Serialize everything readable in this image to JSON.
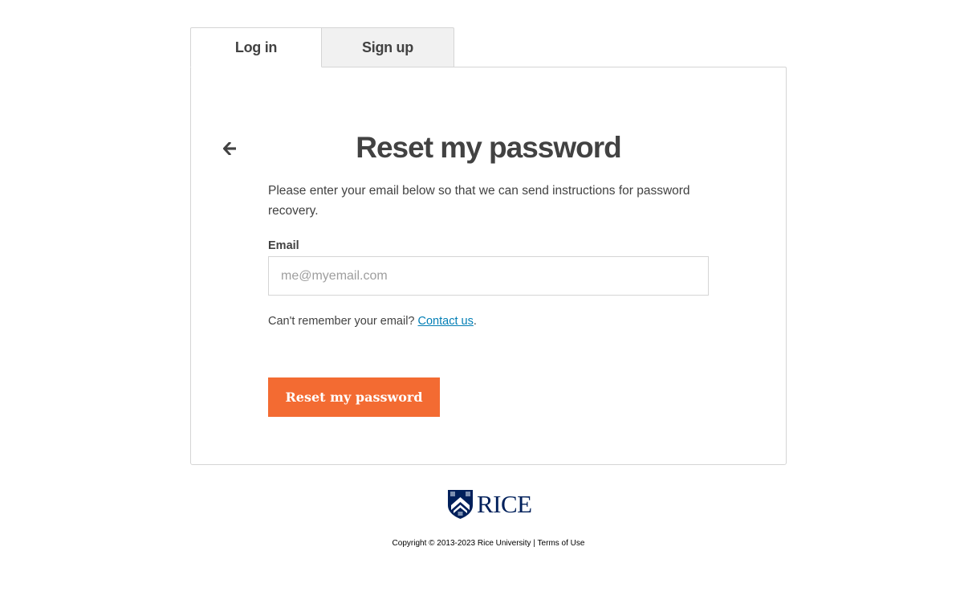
{
  "tabs": {
    "login_label": "Log in",
    "signup_label": "Sign up"
  },
  "reset": {
    "title": "Reset my password",
    "instructions": "Please enter your email below so that we can send instructions for password recovery.",
    "email_label": "Email",
    "email_placeholder": "me@myemail.com",
    "email_value": "",
    "help_prefix": "Can't remember your email? ",
    "help_link": "Contact us",
    "help_suffix": ".",
    "button_label": "Reset my password"
  },
  "footer": {
    "logo_text": "RICE",
    "copyright": "Copyright © 2013-2023 Rice University",
    "separator": " | ",
    "terms_link": "Terms of Use"
  },
  "icons": {
    "back": "arrow-left-icon",
    "logo": "rice-shield-icon"
  },
  "colors": {
    "accent": "#f36b32",
    "link": "#027eb5",
    "brand_navy": "#00205b",
    "text": "#424242"
  }
}
